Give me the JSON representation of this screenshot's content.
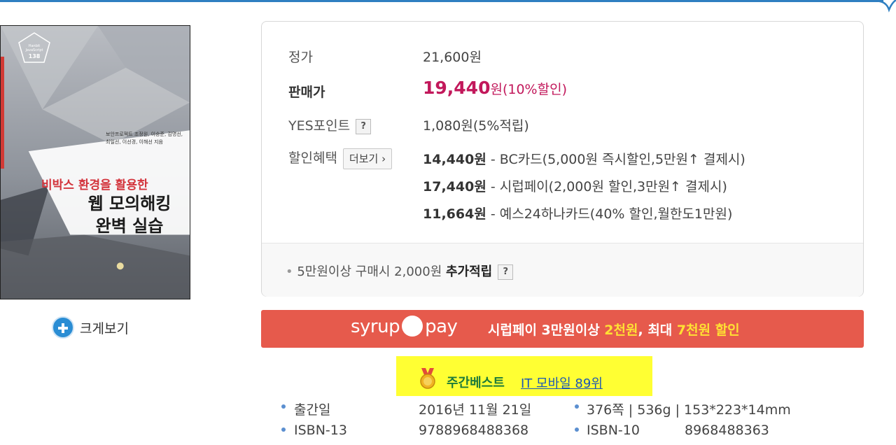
{
  "cover": {
    "series_badge": "Hanbit\nJavaScript\n138",
    "authors": "보안프로젝트 조정원, 이승준, 김명선, 최일선, 이선경, 이해선 지음",
    "subtitle": "비박스 환경을 활용한",
    "title_line1": "웹 모의해킹",
    "title_line2": "완벽 실습"
  },
  "zoom_label": "크게보기",
  "price": {
    "list_label": "정가",
    "list_value": "21,600원",
    "sale_label": "판매가",
    "sale_value": "19,440",
    "sale_unit": "원",
    "sale_discount": "(10%할인)",
    "points_label": "YES포인트",
    "points_value": "1,080원(5%적립)",
    "benefit_label": "할인혜택",
    "more_button": "더보기",
    "benefits": [
      {
        "amount": "14,440원",
        "desc": "- BC카드(5,000원 즉시할인,5만원↑ 결제시)"
      },
      {
        "amount": "17,440원",
        "desc": "- 시럽페이(2,000원 할인,3만원↑ 결제시)"
      },
      {
        "amount": "11,664원",
        "desc": "- 예스24하나카드(40% 할인,월한도1만원)"
      }
    ],
    "extra_prefix": "5만원이상 구매시 2,000원",
    "extra_bold": "추가적립"
  },
  "question_mark": "?",
  "syrup": {
    "logo_left": "syrup",
    "logo_right": "pay",
    "text_a": "시럽페이 3만원이상 ",
    "text_b": "2천원",
    "text_c": ", 최대 ",
    "text_d": "7천원 할인"
  },
  "weekly": {
    "label": "주간베스트",
    "rank": "IT 모바일 89위"
  },
  "info": {
    "pub_label": "출간일",
    "pub_value": "2016년 11월 21일",
    "spec_value": "376쪽 | 536g | 153*223*14mm",
    "isbn13_label": "ISBN-13",
    "isbn13_value": "9788968488368",
    "isbn10_label": "ISBN-10",
    "isbn10_value": "8968488363"
  },
  "colors": {
    "accent": "#2f7fc1",
    "sale": "#c2185b",
    "syrup": "#e65a4c",
    "weekly_bg": "#ffff33"
  }
}
